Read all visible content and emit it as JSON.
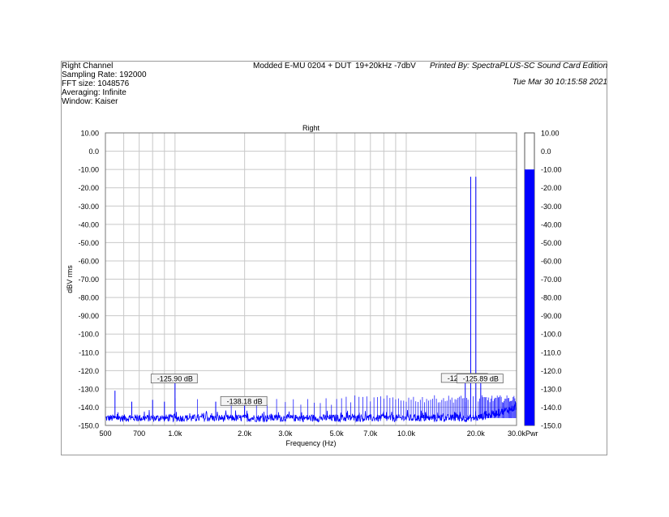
{
  "header": {
    "left_lines": [
      "Right Channel",
      "Sampling Rate: 192000",
      "FFT size: 1048576",
      "Averaging: Infinite",
      "Window: Kaiser"
    ],
    "center": "Modded E-MU 0204 + DUT",
    "center2": "19+20kHz -7dbV",
    "right": "Printed By: SpectraPLUS-SC Sound Card Edition",
    "date": "Tue Mar 30 10:15:58 2021"
  },
  "chart_data": {
    "type": "line",
    "title": "Right",
    "xlabel": "Frequency (Hz)",
    "ylabel": "dBV rms",
    "xscale": "log",
    "xlim": [
      500,
      30000
    ],
    "ylim": [
      -150,
      10
    ],
    "x_ticks": [
      500,
      700,
      1000,
      2000,
      3000,
      5000,
      7000,
      10000,
      20000,
      30000
    ],
    "x_tick_labels": [
      "500",
      "700",
      "1.0k",
      "2.0k",
      "3.0k",
      "5.0k",
      "7.0k",
      "10.0k",
      "20.0k",
      "30.0k"
    ],
    "y_ticks": [
      10,
      0,
      -10,
      -20,
      -30,
      -40,
      -50,
      -60,
      -70,
      -80,
      -90,
      -100,
      -110,
      -120,
      -130,
      -140,
      -150
    ],
    "y_tick_labels": [
      "10.00",
      "0.0",
      "-10.00",
      "-20.00",
      "-30.00",
      "-40.00",
      "-50.00",
      "-60.00",
      "-70.00",
      "-80.00",
      "-90.00",
      "-100.0",
      "-110.0",
      "-120.0",
      "-130.0",
      "-140.0",
      "-150.0"
    ],
    "grid": true,
    "line_color": "#0000ff",
    "noise_floor_dbv": -146,
    "peaks": [
      {
        "f": 19000,
        "db": -14
      },
      {
        "f": 20000,
        "db": -14
      },
      {
        "f": 18000,
        "db": -123
      },
      {
        "f": 21000,
        "db": -123
      },
      {
        "f": 1000,
        "db": -125.9
      },
      {
        "f": 2000,
        "db": -138.2
      },
      {
        "f": 550,
        "db": -131
      },
      {
        "f": 650,
        "db": -137
      },
      {
        "f": 800,
        "db": -136
      },
      {
        "f": 900,
        "db": -137
      },
      {
        "f": 1500,
        "db": -137
      }
    ],
    "annotations": [
      {
        "text": "-125.90 dB",
        "f": 1000,
        "db": -125.9
      },
      {
        "text": "-138.18 dB",
        "f": 2000,
        "db": -138.18
      },
      {
        "text": "-125.57 dB",
        "f": 18000,
        "db": -125.57
      },
      {
        "text": "-125.89 dB",
        "f": 21000,
        "db": -125.89
      }
    ],
    "power_bar": {
      "label": "Pwr",
      "level_db": -10,
      "range": [
        -150,
        10
      ],
      "tick_labels": [
        "10.00",
        "0.0",
        "-10.00",
        "-20.00",
        "-30.00",
        "-40.00",
        "-50.00",
        "-60.00",
        "-70.00",
        "-80.00",
        "-90.00",
        "-100.0",
        "-110.0",
        "-120.0",
        "-130.0",
        "-140.0",
        "-150.0"
      ],
      "color": "#0000ff"
    }
  }
}
